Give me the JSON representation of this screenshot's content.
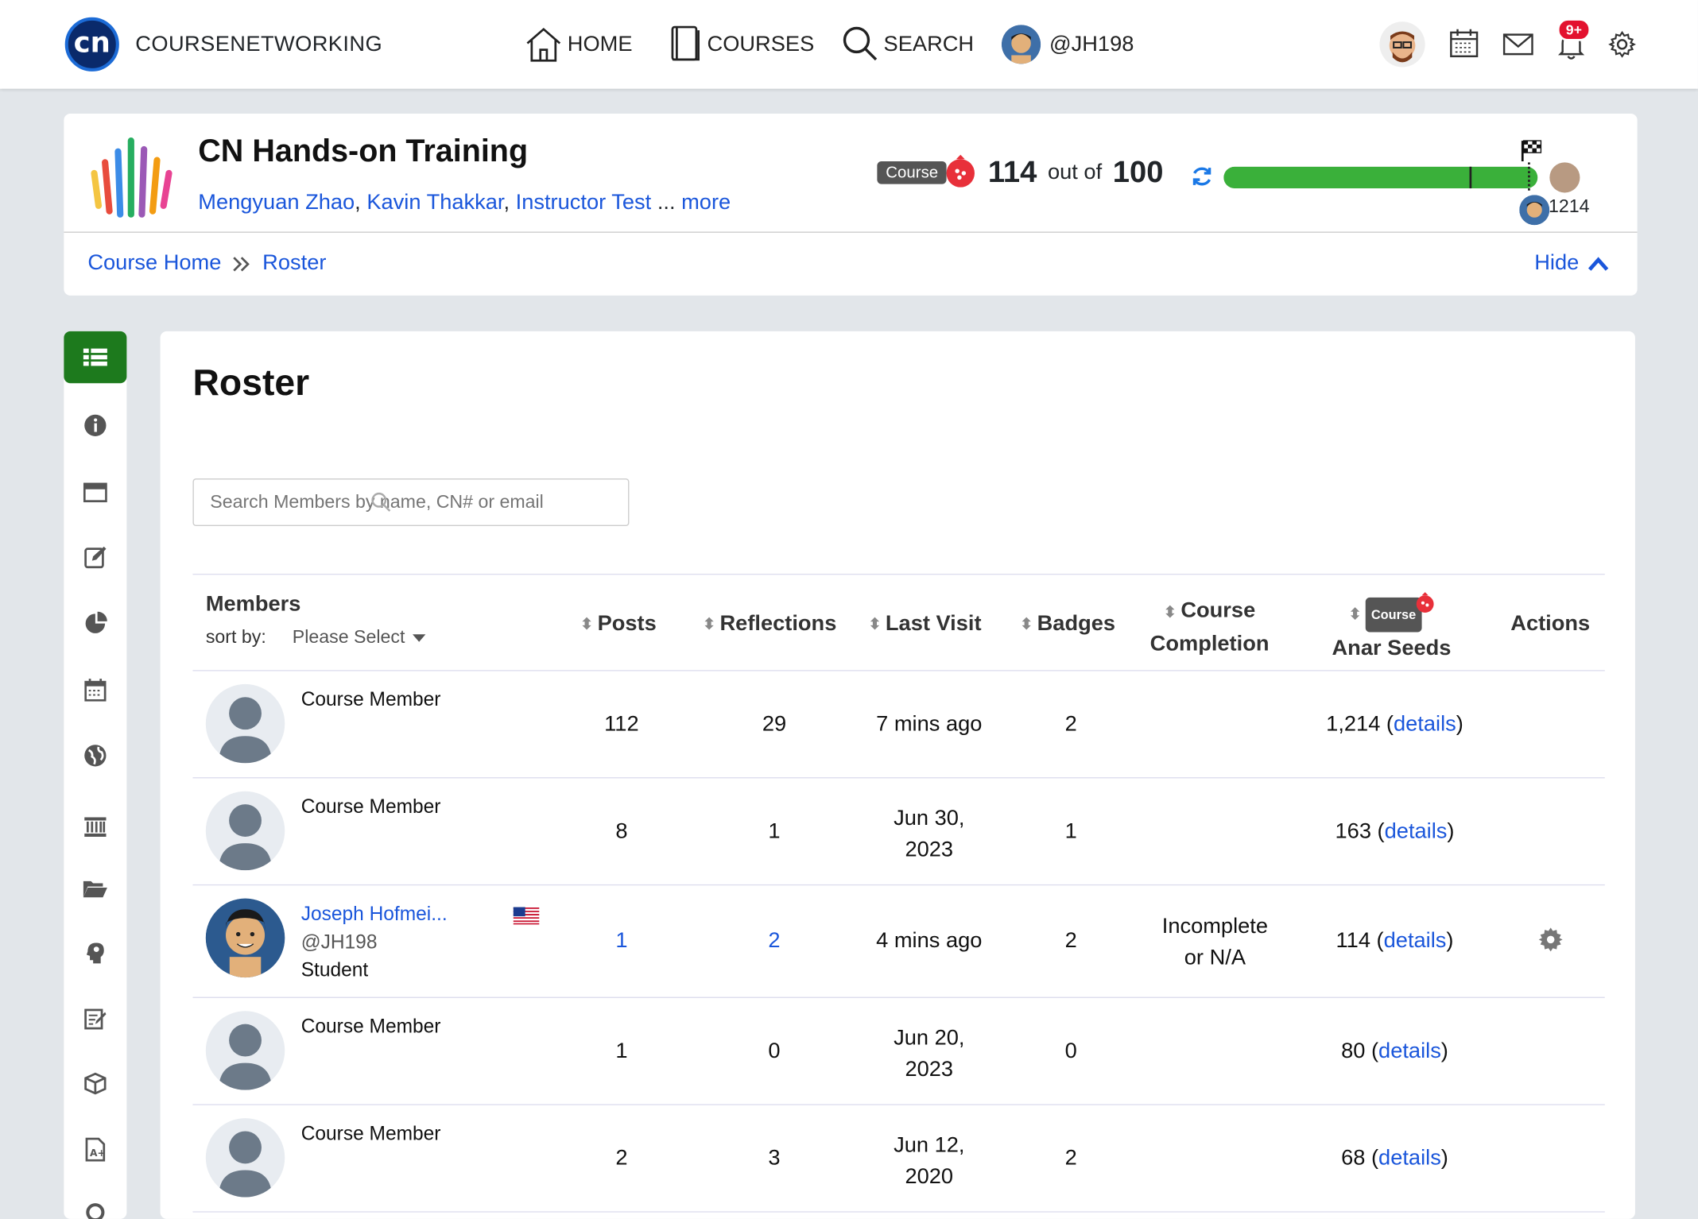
{
  "topbar": {
    "brand": "COURSENETWORKING",
    "logo_text": "cn",
    "nav": [
      {
        "label": "HOME",
        "icon": "home-icon"
      },
      {
        "label": "COURSES",
        "icon": "book-icon"
      },
      {
        "label": "SEARCH",
        "icon": "search-icon"
      },
      {
        "label": "@JH198",
        "icon": "avatar"
      }
    ],
    "notif_badge": "9+"
  },
  "course": {
    "title": "CN Hands-on Training",
    "instructors": [
      "Mengyuan Zhao",
      "Kavin Thakkar",
      "Instructor Test"
    ],
    "more": "more",
    "ellipsis": "...",
    "tag": "Course",
    "score": "114",
    "out_of": "out of",
    "max": "100",
    "progress": 1.0,
    "leader_score": "1214"
  },
  "breadcrumb": {
    "home": "Course Home",
    "current": "Roster",
    "hide": "Hide"
  },
  "roster": {
    "title": "Roster",
    "search_placeholder": "Search Members by name, CN# or email",
    "headers": {
      "members": "Members",
      "sort_by": "sort by:",
      "sort_select": "Please Select",
      "posts": "Posts",
      "reflections": "Reflections",
      "last_visit": "Last Visit",
      "badges": "Badges",
      "completion1": "Course",
      "completion2": "Completion",
      "seeds_tag": "Course",
      "seeds": "Anar Seeds",
      "actions": "Actions"
    },
    "details": "details",
    "rows": [
      {
        "name": "Course Member",
        "posts": "112",
        "reflections": "29",
        "last_visit": "7 mins ago",
        "badges": "2",
        "completion": "",
        "seeds": "1,214"
      },
      {
        "name": "Course Member",
        "posts": "8",
        "reflections": "1",
        "last_visit": "Jun 30, 2023",
        "badges": "1",
        "completion": "",
        "seeds": "163"
      },
      {
        "name": "Joseph Hofmei...",
        "handle": "@JH198",
        "role": "Student",
        "posts": "1",
        "reflections": "2",
        "last_visit": "4 mins ago",
        "badges": "2",
        "completion": "Incomplete or N/A",
        "seeds": "114"
      },
      {
        "name": "Course Member",
        "posts": "1",
        "reflections": "0",
        "last_visit": "Jun 20, 2023",
        "badges": "0",
        "completion": "",
        "seeds": "80"
      },
      {
        "name": "Course Member",
        "posts": "2",
        "reflections": "3",
        "last_visit": "Jun 12, 2020",
        "badges": "2",
        "completion": "",
        "seeds": "68"
      }
    ]
  },
  "colors": {
    "accent": "#1a56db",
    "active_green": "#1d7a1d",
    "progress_green": "#3ab03a",
    "notif_red": "#e3122f"
  }
}
